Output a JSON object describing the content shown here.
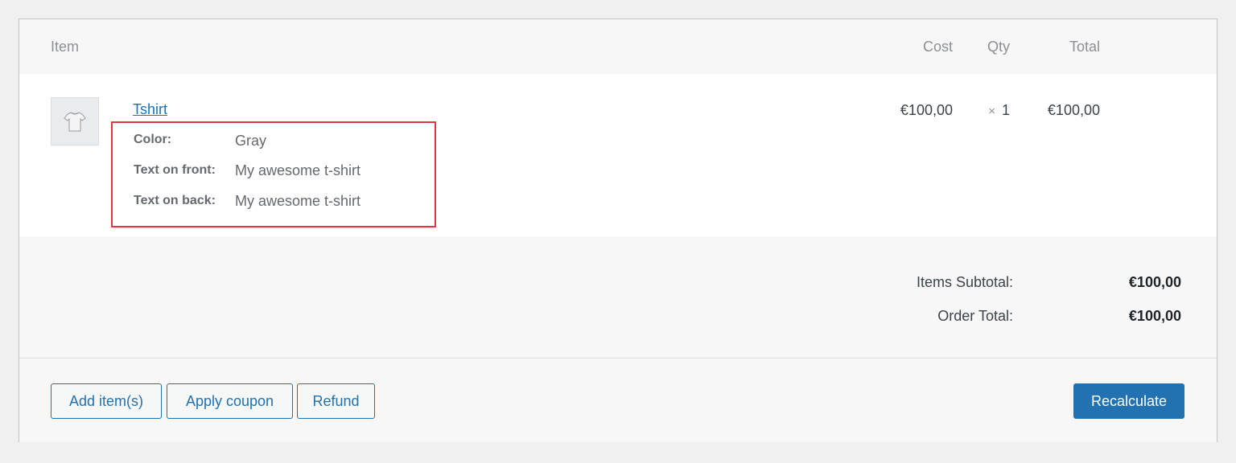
{
  "columns": {
    "item": "Item",
    "cost": "Cost",
    "qty": "Qty",
    "total": "Total"
  },
  "line_item": {
    "name": "Tshirt",
    "thumbnail_icon": "tshirt-icon",
    "cost": "€100,00",
    "qty_prefix": "×",
    "qty": "1",
    "total": "€100,00",
    "meta": [
      {
        "key": "Color:",
        "value": "Gray"
      },
      {
        "key": "Text on front:",
        "value": "My awesome t-shirt"
      },
      {
        "key": "Text on back:",
        "value": "My awesome t-shirt"
      }
    ]
  },
  "totals": {
    "subtotal_label": "Items Subtotal:",
    "subtotal_value": "€100,00",
    "order_total_label": "Order Total:",
    "order_total_value": "€100,00"
  },
  "actions": {
    "add_items": "Add item(s)",
    "apply_coupon": "Apply coupon",
    "refund": "Refund",
    "recalculate": "Recalculate"
  },
  "colors": {
    "accent": "#2271b1",
    "highlight_border": "#e2373a"
  }
}
